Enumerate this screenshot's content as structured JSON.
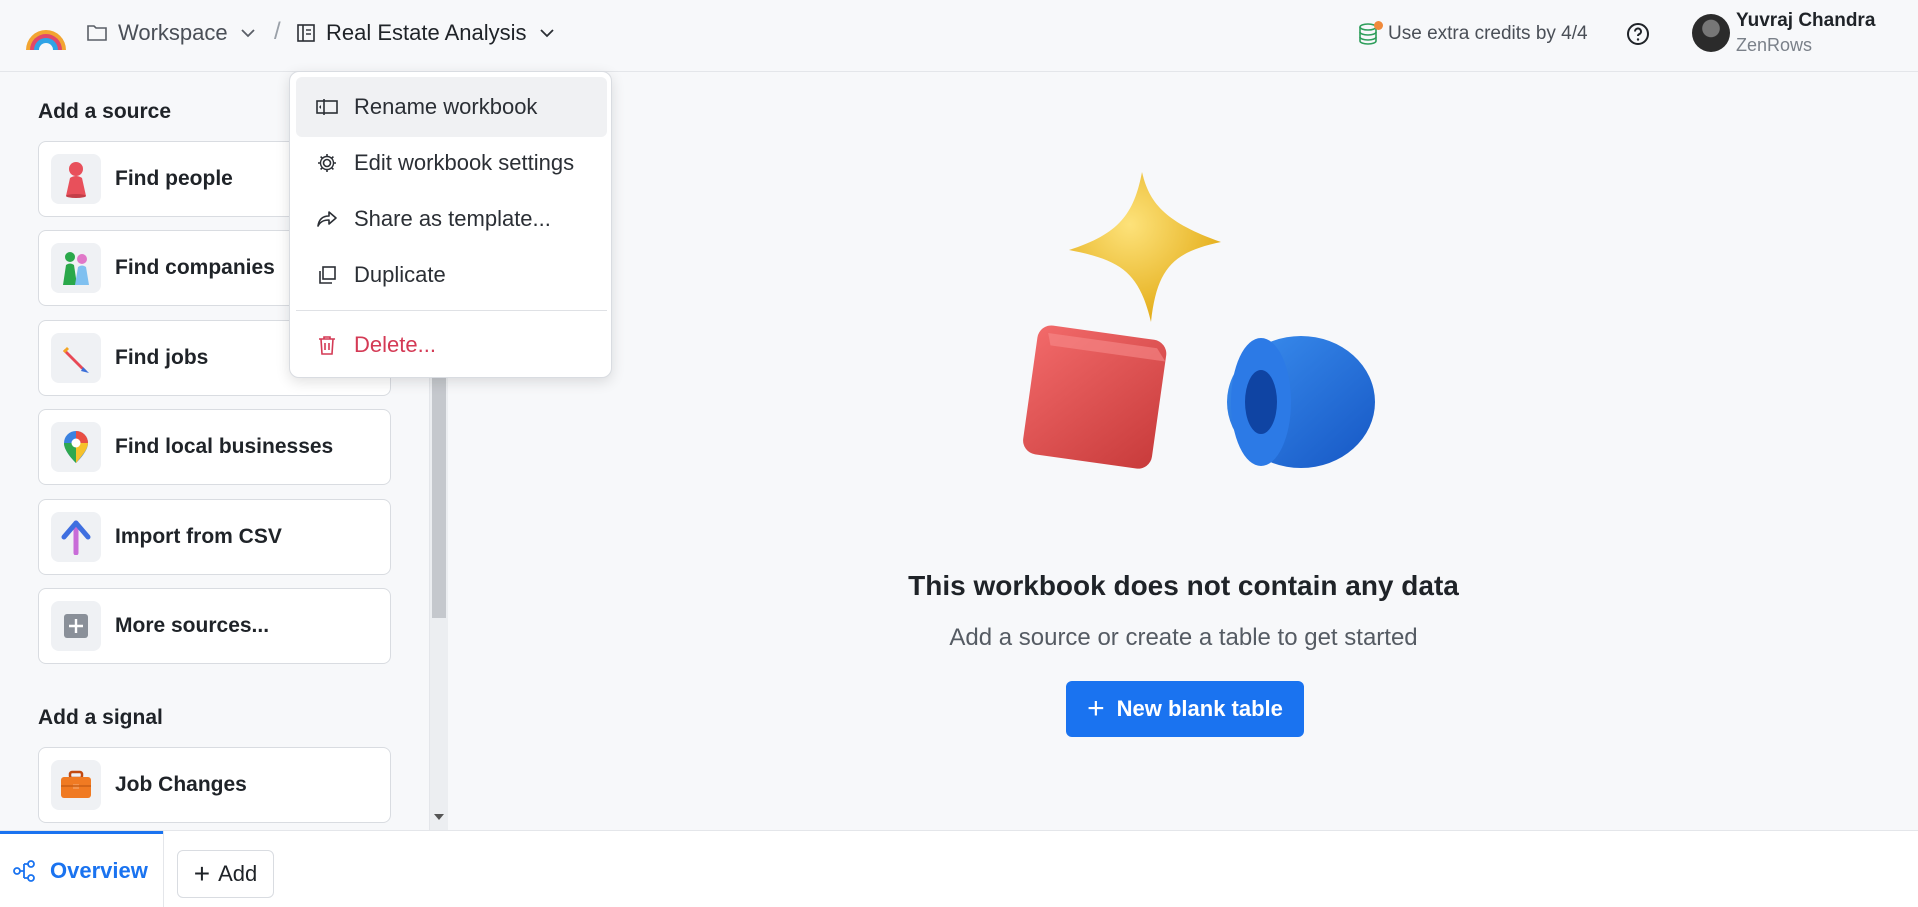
{
  "header": {
    "workspace_label": "Workspace",
    "separator": "/",
    "workbook_title": "Real Estate Analysis",
    "credits_text": "Use extra credits by 4/4",
    "user_name": "Yuvraj Chandra",
    "user_org": "ZenRows"
  },
  "workbook_menu": {
    "items": [
      {
        "label": "Rename workbook",
        "icon": "rename-icon"
      },
      {
        "label": "Edit workbook settings",
        "icon": "gear-icon"
      },
      {
        "label": "Share as template...",
        "icon": "share-icon"
      },
      {
        "label": "Duplicate",
        "icon": "duplicate-icon"
      }
    ],
    "delete_label": "Delete..."
  },
  "sidebar": {
    "sources_title": "Add a source",
    "sources": [
      {
        "label": "Find people",
        "icon": "person-icon"
      },
      {
        "label": "Find companies",
        "icon": "companies-icon"
      },
      {
        "label": "Find jobs",
        "icon": "pencil-icon"
      },
      {
        "label": "Find local businesses",
        "icon": "map-pin-icon"
      },
      {
        "label": "Import from CSV",
        "icon": "arrow-up-icon"
      },
      {
        "label": "More sources...",
        "icon": "plus-square-icon"
      }
    ],
    "signals_title": "Add a signal",
    "signals": [
      {
        "label": "Job Changes",
        "icon": "briefcase-icon"
      }
    ]
  },
  "main": {
    "empty_title": "This workbook does not contain any data",
    "empty_subtitle": "Add a source or create a table to get started",
    "new_table_label": "New blank table"
  },
  "bottom": {
    "overview_label": "Overview",
    "add_label": "Add"
  },
  "colors": {
    "accent": "#1a73f0",
    "danger": "#d43a55",
    "credits_dot": "#f08a3a"
  }
}
